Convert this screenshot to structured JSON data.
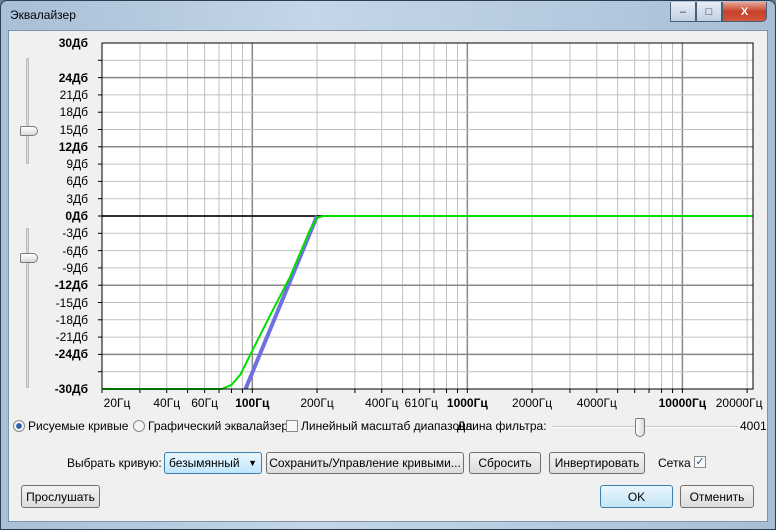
{
  "window": {
    "title": "Эквалайзер",
    "minimize": "–",
    "maximize": "□",
    "close": "X"
  },
  "chart_data": {
    "type": "line",
    "xscale": "log",
    "xlim": [
      20,
      21300
    ],
    "ylim": [
      -30,
      30
    ],
    "grid": true,
    "y_ticks": [
      {
        "v": 30,
        "label": "30Дб",
        "bold": true
      },
      {
        "v": 24,
        "label": "24Дб",
        "bold": true
      },
      {
        "v": 21,
        "label": "21Дб"
      },
      {
        "v": 18,
        "label": "18Дб"
      },
      {
        "v": 15,
        "label": "15Дб"
      },
      {
        "v": 12,
        "label": "12Дб",
        "bold": true
      },
      {
        "v": 9,
        "label": "9Дб"
      },
      {
        "v": 6,
        "label": "6Дб"
      },
      {
        "v": 3,
        "label": "3Дб"
      },
      {
        "v": 0,
        "label": "0Дб",
        "bold": true
      },
      {
        "v": -3,
        "label": "-3Дб"
      },
      {
        "v": -6,
        "label": "-6Дб"
      },
      {
        "v": -9,
        "label": "-9Дб"
      },
      {
        "v": -12,
        "label": "-12Дб",
        "bold": true
      },
      {
        "v": -15,
        "label": "-15Дб"
      },
      {
        "v": -18,
        "label": "-18Дб"
      },
      {
        "v": -21,
        "label": "-21Дб"
      },
      {
        "v": -24,
        "label": "-24Дб",
        "bold": true
      },
      {
        "v": -30,
        "label": "-30Дб",
        "bold": true
      }
    ],
    "x_ticks": [
      {
        "v": 20,
        "label": "20Гц"
      },
      {
        "v": 40,
        "label": "40Гц"
      },
      {
        "v": 60,
        "label": "60Гц"
      },
      {
        "v": 100,
        "label": "100Гц",
        "bold": true
      },
      {
        "v": 200,
        "label": "200Гц"
      },
      {
        "v": 400,
        "label": "400Гц"
      },
      {
        "v": 610,
        "label": "610Гц"
      },
      {
        "v": 1000,
        "label": "1000Гц",
        "bold": true
      },
      {
        "v": 2000,
        "label": "2000Гц"
      },
      {
        "v": 4000,
        "label": "4000Гц"
      },
      {
        "v": 10000,
        "label": "10000Гц",
        "bold": true
      },
      {
        "v": 20000,
        "label": "20000Гц"
      }
    ],
    "series": [
      {
        "name": "drawn-curve",
        "color": "#7070e0",
        "points": [
          [
            93,
            -30
          ],
          [
            200,
            0
          ]
        ]
      },
      {
        "name": "response",
        "color": "#00e000",
        "points": [
          [
            20,
            -30
          ],
          [
            72,
            -30
          ],
          [
            80,
            -29.3
          ],
          [
            88,
            -27.5
          ],
          [
            95,
            -25
          ],
          [
            120,
            -17.5
          ],
          [
            150,
            -10.5
          ],
          [
            185,
            -2.5
          ],
          [
            200,
            -0.3
          ],
          [
            215,
            0
          ],
          [
            21300,
            0
          ]
        ]
      }
    ],
    "zero_line_color": "#000000"
  },
  "controls": {
    "radio_drawn": "Рисуемые кривые",
    "radio_graphic": "Графический эквалайзер",
    "linear_scale": "Линейный масштаб диапазона",
    "filter_length_label": "Длина фильтра:",
    "filter_length_value": "4001",
    "filter_length_fraction": 0.44,
    "select_curve_label": "Выбрать кривую:",
    "curve_value": "безымянный",
    "save_manage": "Сохранить/Управление кривыми...",
    "reset": "Сбросить",
    "invert": "Инвертировать",
    "grid_label": "Сетка",
    "grid_check": "✓",
    "preview": "Прослушать",
    "ok": "OK",
    "cancel": "Отменить"
  }
}
